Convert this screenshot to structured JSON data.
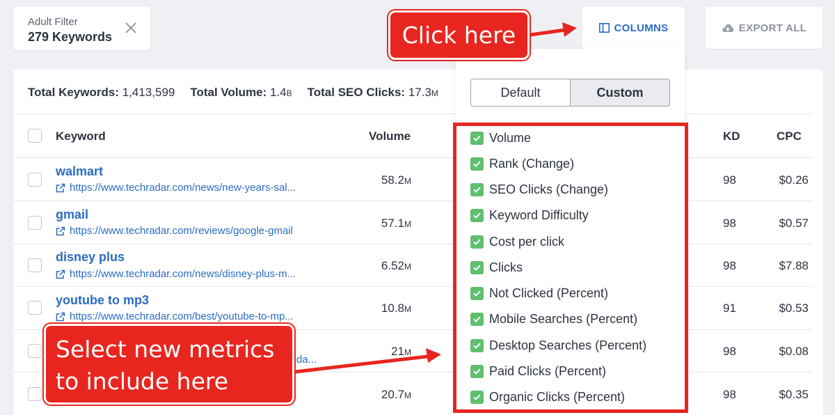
{
  "filter_chip": {
    "label": "Adult Filter",
    "value": "279 Keywords"
  },
  "buttons": {
    "columns": "COLUMNS",
    "export": "EXPORT ALL"
  },
  "totals": {
    "keywords_label": "Total Keywords:",
    "keywords_value": "1,413,599",
    "volume_label": "Total Volume:",
    "volume_value": "1.4",
    "volume_unit": "B",
    "seo_label": "Total SEO Clicks:",
    "seo_value": "17.3",
    "seo_unit": "M"
  },
  "table": {
    "headers": {
      "keyword": "Keyword",
      "volume": "Volume",
      "kd": "KD",
      "cpc": "CPC"
    },
    "rows": [
      {
        "keyword": "walmart",
        "url": "https://www.techradar.com/news/new-years-sal...",
        "volume": "58.2",
        "unit": "M",
        "kd": "98",
        "cpc": "$0.26"
      },
      {
        "keyword": "gmail",
        "url": "https://www.techradar.com/reviews/google-gmail",
        "volume": "57.1",
        "unit": "M",
        "kd": "98",
        "cpc": "$0.57"
      },
      {
        "keyword": "disney plus",
        "url": "https://www.techradar.com/news/disney-plus-m...",
        "volume": "6.52",
        "unit": "M",
        "kd": "98",
        "cpc": "$7.88"
      },
      {
        "keyword": "youtube to mp3",
        "url": "https://www.techradar.com/best/youtube-to-mp...",
        "volume": "10.8",
        "unit": "M",
        "kd": "91",
        "cpc": "$0.53"
      },
      {
        "keyword": "",
        "url": "-da...",
        "volume": "21",
        "unit": "M",
        "kd": "98",
        "cpc": "$0.08"
      },
      {
        "keyword": "",
        "url": "",
        "volume": "20.7",
        "unit": "M",
        "kd": "98",
        "cpc": "$0.35"
      }
    ]
  },
  "dropdown": {
    "segment": {
      "default": "Default",
      "custom": "Custom",
      "selected": "Custom"
    },
    "options": [
      {
        "label": "Volume",
        "checked": true
      },
      {
        "label": "Rank (Change)",
        "checked": true
      },
      {
        "label": "SEO Clicks (Change)",
        "checked": true
      },
      {
        "label": "Keyword Difficulty",
        "checked": true
      },
      {
        "label": "Cost per click",
        "checked": true
      },
      {
        "label": "Clicks",
        "checked": true
      },
      {
        "label": "Not Clicked (Percent)",
        "checked": true
      },
      {
        "label": "Mobile Searches (Percent)",
        "checked": true
      },
      {
        "label": "Desktop Searches (Percent)",
        "checked": true
      },
      {
        "label": "Paid Clicks (Percent)",
        "checked": true
      },
      {
        "label": "Organic Clicks (Percent)",
        "checked": true
      }
    ]
  },
  "annotations": {
    "callout_1": "Click here",
    "callout_2_line1": "Select new metrics",
    "callout_2_line2": "to include here"
  },
  "colors": {
    "accent": "#2b6cc4",
    "check": "#5fbf6d",
    "annotation": "#e8261f"
  },
  "icons": {
    "close": "close-icon",
    "columns": "columns-icon",
    "export": "cloud-download-icon",
    "link": "external-link-icon",
    "check": "check-icon"
  }
}
